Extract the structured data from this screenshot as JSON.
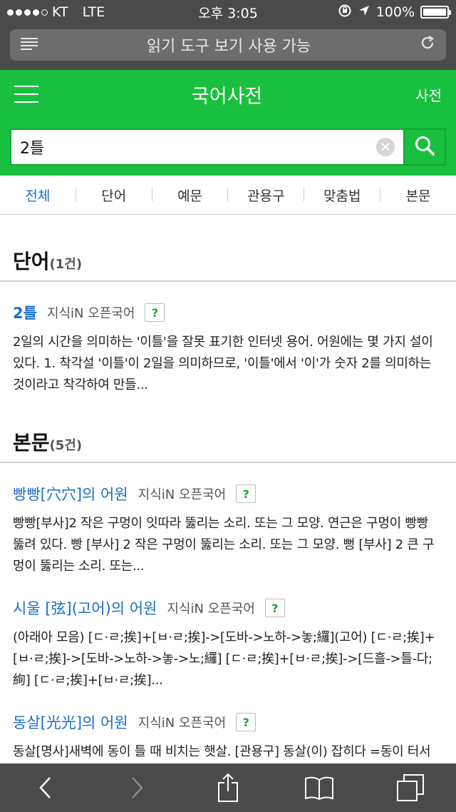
{
  "status": {
    "carrier": "KT",
    "network": "LTE",
    "time": "오후 3:05",
    "battery": "100%"
  },
  "browser": {
    "url_text": "읽기 도구 보기 사용 가능"
  },
  "header": {
    "title": "국어사전",
    "right_link": "사전"
  },
  "search": {
    "query": "2틀"
  },
  "tabs": [
    "전체",
    "단어",
    "예문",
    "관용구",
    "맞춤법",
    "본문"
  ],
  "sections": {
    "words": {
      "title": "단어",
      "count": "(1건)",
      "entries": [
        {
          "title": "2틀",
          "source": "지식iN 오픈국어",
          "badge": "?",
          "body": "2일의 시간을 의미하는 '이틀'을 잘못 표기한 인터넷 용어. 어원에는 몇 가지 설이 있다. 1. 착각설 '이틀'이 2일을 의미하므로, '이틀'에서 '이'가 숫자 2를 의미하는 것이라고 착각하여 만들..."
        }
      ]
    },
    "texts": {
      "title": "본문",
      "count": "(5건)",
      "entries": [
        {
          "title": "빵빵[穴穴]의 어원",
          "source": "지식iN 오픈국어",
          "badge": "?",
          "body": "빵빵[부사]2 작은 구멍이 잇따라 뚫리는 소리. 또는 그 모양. 연근은 구멍이 빵빵 뚫려 있다. 빵 [부사] 2 작은 구멍이 뚫리는 소리. 또는 그 모양. 뻥 [부사] 2 큰 구멍이 뚫리는 소리. 또는..."
        },
        {
          "title": "시울 [弦](고어)의 어원",
          "source": "지식iN 오픈국어",
          "badge": "?",
          "body": "(아래아 모음) [ㄷ·ㄹ;挨]+[ㅂ·ㄹ;挨]->[도바->노하->놓;纙](고어) [ㄷ·ㄹ;挨]+[ㅂ·ㄹ;挨]->[도바->노하->놓->노;纙] [ㄷ·ㄹ;挨]+[ㅂ·ㄹ;挨]->[드흘->틀-다;絢] [ㄷ·ㄹ;挨]+[ㅂ·ㄹ;挨]..."
        },
        {
          "title": "동살[光光]의 어원",
          "source": "지식iN 오픈국어",
          "badge": "?",
          "body": "동살[명사]새벽에 동이 틀 때 비치는 햇살. [관용구] 동살(이) 잡히다 =동이 터서"
        }
      ]
    }
  },
  "icons": {
    "menu": "hamburger-icon",
    "search": "search-icon",
    "clear": "clear-icon",
    "reload": "reload-icon",
    "back": "back-icon",
    "forward": "forward-icon",
    "share": "share-icon",
    "bookmarks": "bookmarks-icon",
    "tabs": "tabs-icon"
  },
  "colors": {
    "brand_green": "#19c03f",
    "link_blue": "#1a6ec8"
  }
}
